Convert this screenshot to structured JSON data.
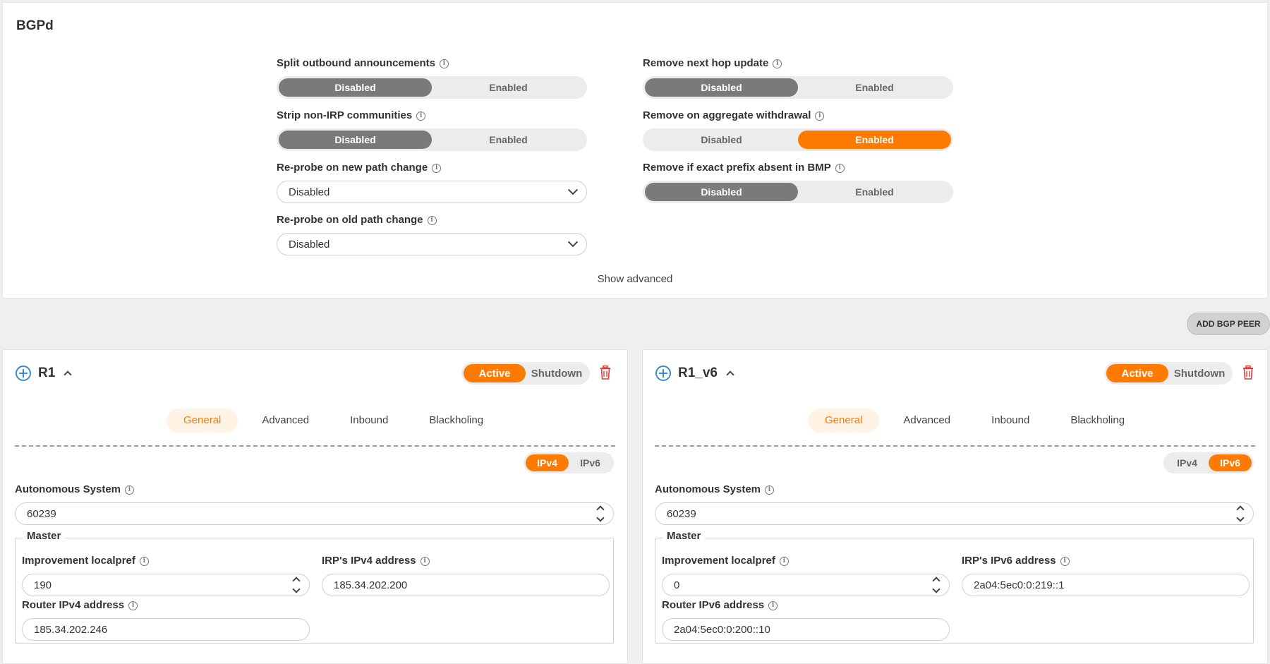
{
  "bgpd": {
    "title": "BGPd",
    "split_outbound": {
      "label": "Split outbound announcements",
      "options": [
        "Disabled",
        "Enabled"
      ],
      "selected": "Disabled"
    },
    "remove_next_hop": {
      "label": "Remove next hop update",
      "options": [
        "Disabled",
        "Enabled"
      ],
      "selected": "Disabled"
    },
    "strip_non_irp": {
      "label": "Strip non-IRP communities",
      "options": [
        "Disabled",
        "Enabled"
      ],
      "selected": "Disabled"
    },
    "remove_aggregate": {
      "label": "Remove on aggregate withdrawal",
      "options": [
        "Disabled",
        "Enabled"
      ],
      "selected": "Enabled"
    },
    "reprobe_new": {
      "label": "Re-probe on new path change",
      "value": "Disabled"
    },
    "remove_exact_prefix": {
      "label": "Remove if exact prefix absent in BMP",
      "options": [
        "Disabled",
        "Enabled"
      ],
      "selected": "Disabled"
    },
    "reprobe_old": {
      "label": "Re-probe on old path change",
      "value": "Disabled"
    },
    "show_advanced": "Show advanced"
  },
  "add_bgp_peer": "ADD BGP PEER",
  "peers": [
    {
      "name": "R1",
      "state_options": [
        "Active",
        "Shutdown"
      ],
      "tabs": [
        "General",
        "Advanced",
        "Inbound",
        "Blackholing"
      ],
      "ip_options": [
        "IPv4",
        "IPv6"
      ],
      "as_label": "Autonomous System",
      "as_value": "60239",
      "master_label": "Master",
      "localpref_label": "Improvement localpref",
      "localpref_value": "190",
      "irp_addr_label": "IRP's IPv4 address",
      "irp_addr_value": "185.34.202.200",
      "router_addr_label": "Router IPv4 address",
      "router_addr_value": "185.34.202.246"
    },
    {
      "name": "R1_v6",
      "state_options": [
        "Active",
        "Shutdown"
      ],
      "tabs": [
        "General",
        "Advanced",
        "Inbound",
        "Blackholing"
      ],
      "ip_options": [
        "IPv4",
        "IPv6"
      ],
      "as_label": "Autonomous System",
      "as_value": "60239",
      "master_label": "Master",
      "localpref_label": "Improvement localpref",
      "localpref_value": "0",
      "irp_addr_label": "IRP's IPv6 address",
      "irp_addr_value": "2a04:5ec0:0:219::1",
      "router_addr_label": "Router IPv6 address",
      "router_addr_value": "2a04:5ec0:0:200::10"
    }
  ],
  "colors": {
    "accent": "#ff7a00",
    "selected_gray": "#7a7a7a",
    "icon_blue": "#3b8bd6",
    "danger": "#e53935"
  }
}
